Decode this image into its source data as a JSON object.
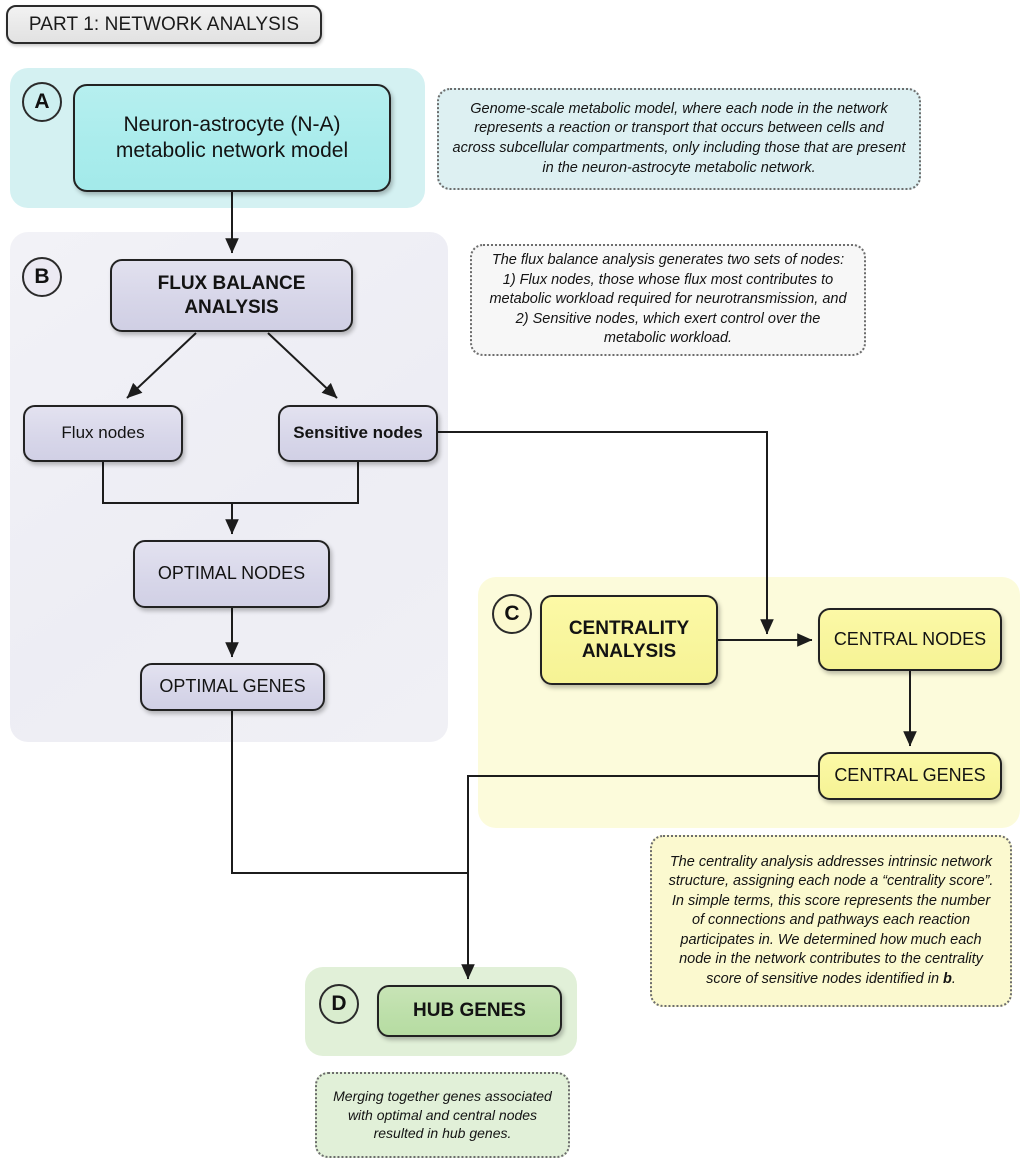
{
  "title_bar": {
    "label": "PART 1: NETWORK ANALYSIS"
  },
  "panels": [
    {
      "id": "A",
      "badge": "A",
      "accent": "#d4f1f2"
    },
    {
      "id": "B",
      "badge": "B",
      "accent": "#f0f0f5"
    },
    {
      "id": "C",
      "badge": "C",
      "accent": "#fcfbdb"
    },
    {
      "id": "D",
      "badge": "D",
      "accent": "#e1f0d8"
    }
  ],
  "nodes": {
    "na_model": "Neuron-astrocyte (N-A)\nmetabolic network model",
    "na_model_line1": "Neuron-astrocyte (N-A)",
    "na_model_line2": "metabolic network model",
    "fba_line1": "FLUX BALANCE",
    "fba_line2": "ANALYSIS",
    "flux_nodes": "Flux nodes",
    "sensitive_nodes": "Sensitive nodes",
    "optimal_nodes": "OPTIMAL NODES",
    "optimal_genes": "OPTIMAL GENES",
    "centrality_line1": "CENTRALITY",
    "centrality_line2": "ANALYSIS",
    "central_nodes": "CENTRAL NODES",
    "central_genes": "CENTRAL GENES",
    "hub_genes": "HUB GENES"
  },
  "notes": {
    "a": "Genome-scale metabolic model, where each node in the network represents a reaction or transport that occurs between cells and across subcellular compartments, only including those that are present in the neuron-astrocyte metabolic network.",
    "b": "The flux balance analysis generates two sets of nodes: 1) Flux nodes, those whose flux most contributes to metabolic workload required for neurotransmission, and 2) Sensitive nodes, which exert control over the metabolic workload.",
    "c_part1": "The centrality analysis addresses intrinsic network structure, assigning each node a “centrality score”. In simple terms, this score represents the number of connections and pathways each reaction participates in. We determined how much each node in the network contributes to the centrality score of sensitive nodes identified in ",
    "c_bold": "b",
    "c_part2": ".",
    "d": "Merging together genes associated with optimal and central nodes resulted in hub genes."
  },
  "colors": {
    "panel_a": "#d4f1f2",
    "panel_b": "#f0f0f5",
    "panel_c": "#fcfbdb",
    "panel_d": "#e1f0d8",
    "node_a": "#a9ecec",
    "node_b": "#d7d6e9",
    "node_c": "#f8f59c",
    "node_d": "#bcdfa9",
    "stroke": "#222222",
    "note_border": "#6d6d6d"
  }
}
